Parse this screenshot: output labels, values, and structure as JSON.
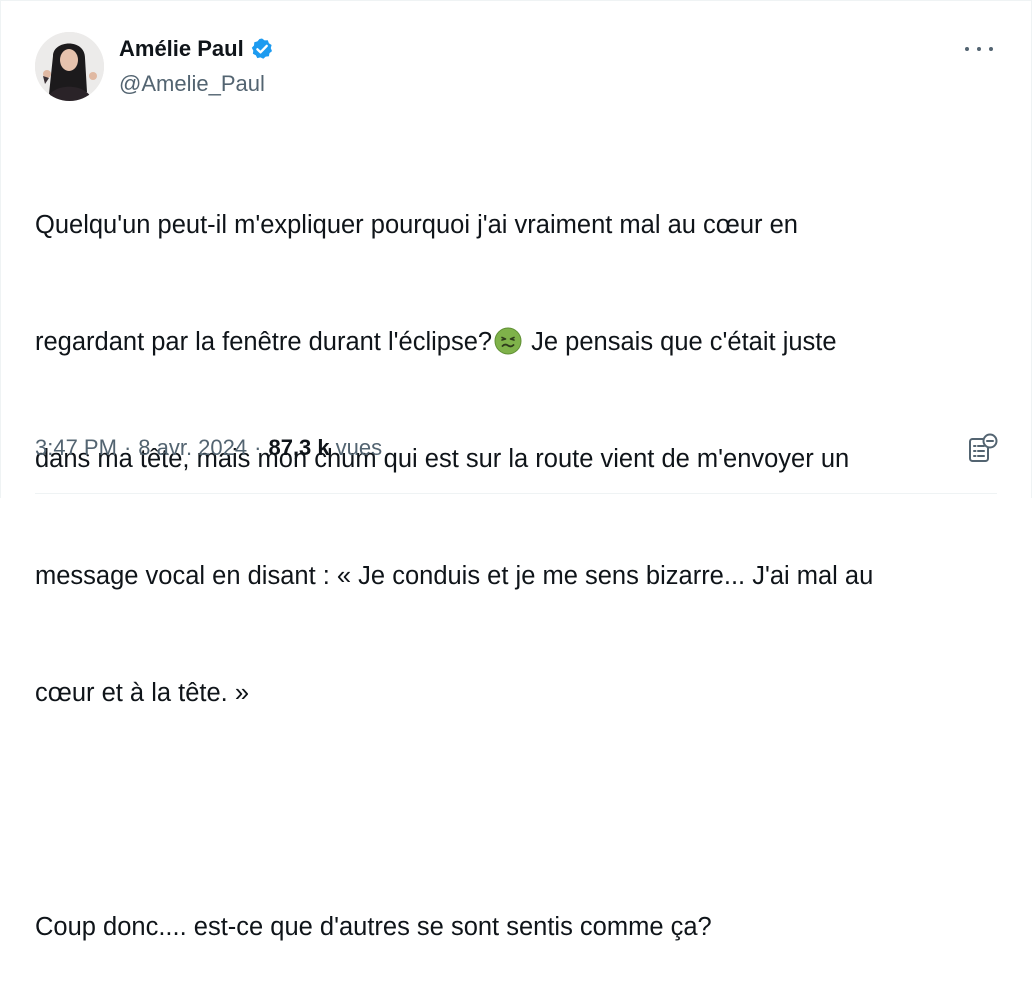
{
  "author": {
    "display_name": "Amélie Paul",
    "handle": "@Amelie_Paul",
    "verified": true,
    "verified_color": "#1d9bf0"
  },
  "tweet": {
    "lines": [
      "Quelqu'un peut-il m'expliquer pourquoi j'ai vraiment mal au cœur en",
      "regardant par la fenêtre durant l'éclipse?",
      " Je pensais que c'était juste",
      "dans ma tête, mais mon chum qui est sur la route vient de m'envoyer un",
      "message vocal en disant : « Je conduis et je me sens bizarre... J'ai mal au",
      "cœur et à la tête. »",
      "",
      "Coup donc.... est-ce que d'autres se sont sentis comme ça?"
    ],
    "emoji": "nauseated-face-icon"
  },
  "meta": {
    "time": "3:47 PM",
    "separator": "·",
    "date": "8 avr. 2024",
    "views_count": "87,3 k",
    "views_label": "vues"
  },
  "icons": {
    "more": "more-options-icon",
    "analytics": "analytics-icon"
  }
}
